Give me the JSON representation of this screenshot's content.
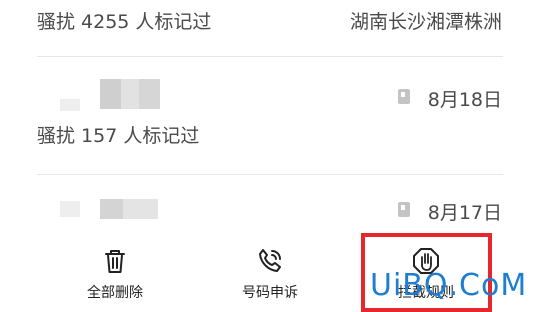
{
  "records": [
    {
      "tag": "骚扰  4255 人标记过",
      "location": "湖南长沙湘潭株洲"
    },
    {
      "tag": "骚扰  157 人标记过",
      "date": "8月18日"
    },
    {
      "date": "8月17日"
    }
  ],
  "actions": [
    {
      "label": "全部删除",
      "icon": "trash-icon"
    },
    {
      "label": "号码申诉",
      "icon": "phone-appeal-icon"
    },
    {
      "label": "拦截规则",
      "icon": "stop-hand-icon"
    }
  ],
  "watermark": {
    "brand": "UiBQ.CoM"
  },
  "colors": {
    "highlight": "#e8262d",
    "watermark": "#1e7fd0"
  }
}
